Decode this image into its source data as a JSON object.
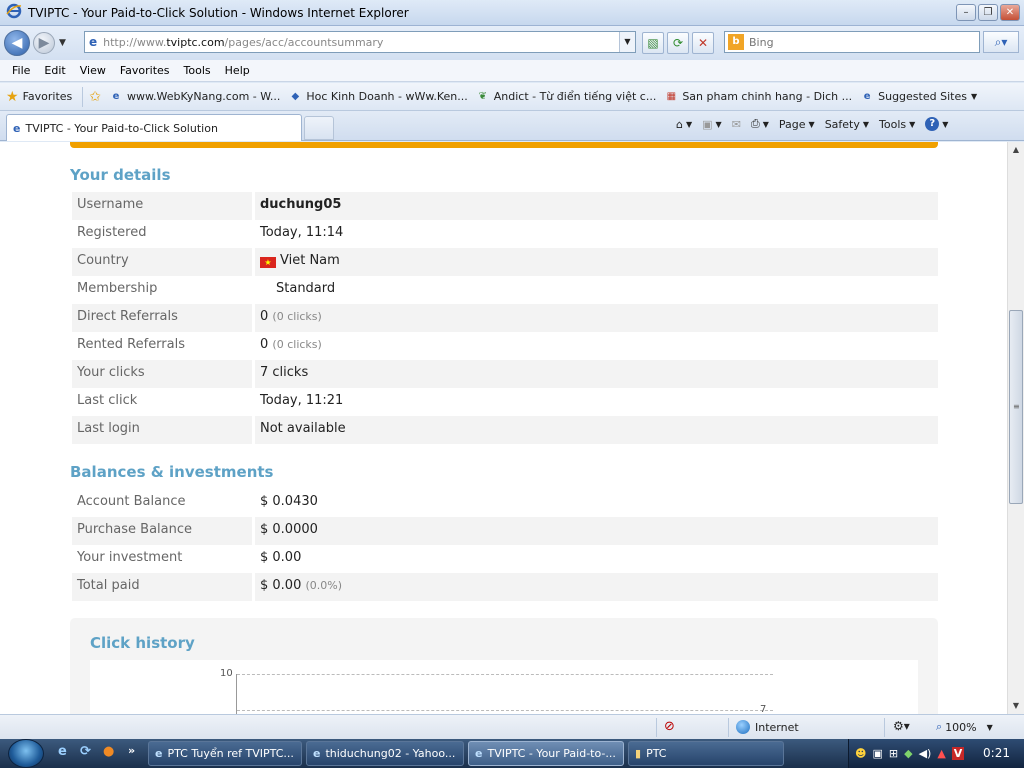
{
  "window": {
    "title": "TVIPTC - Your Paid-to-Click Solution - Windows Internet Explorer",
    "controls": [
      "–",
      "❐",
      "✕"
    ]
  },
  "address_bar": {
    "url_prefix": "http://www.",
    "url_domain": "tviptc.com",
    "url_path": "/pages/acc/accountsummary",
    "search_placeholder": "Bing"
  },
  "menu": [
    "File",
    "Edit",
    "View",
    "Favorites",
    "Tools",
    "Help"
  ],
  "favorites_bar": {
    "label": "Favorites",
    "items": [
      {
        "label": "www.WebKyNang.com - W...",
        "icon": "e"
      },
      {
        "label": "Hoc Kinh Doanh - wWw.Ken...",
        "icon": "◆"
      },
      {
        "label": "Andict - Từ điển tiếng việt c...",
        "icon": "❦"
      },
      {
        "label": "San pham chinh hang - Dich ...",
        "icon": "▦"
      },
      {
        "label": "Suggested Sites",
        "icon": "e"
      }
    ]
  },
  "tab": {
    "label": "TVIPTC - Your Paid-to-Click Solution"
  },
  "command_bar": {
    "page": "Page",
    "safety": "Safety",
    "tools": "Tools"
  },
  "details": {
    "title": "Your details",
    "rows": [
      {
        "label": "Username",
        "value": "duchung05",
        "note": ""
      },
      {
        "label": "Registered",
        "value": "Today, 11:14",
        "note": ""
      },
      {
        "label": "Country",
        "value": "Viet Nam",
        "note": ""
      },
      {
        "label": "Membership",
        "value": "Standard",
        "note": ""
      },
      {
        "label": "Direct Referrals",
        "value": "0",
        "note": "(0 clicks)"
      },
      {
        "label": "Rented Referrals",
        "value": "0",
        "note": "(0 clicks)"
      },
      {
        "label": "Your clicks",
        "value": "7 clicks",
        "note": ""
      },
      {
        "label": "Last click",
        "value": "Today, 11:21",
        "note": ""
      },
      {
        "label": "Last login",
        "value": "Not available",
        "note": ""
      }
    ]
  },
  "balances": {
    "title": "Balances & investments",
    "rows": [
      {
        "label": "Account Balance",
        "value": "$ 0.0430",
        "note": ""
      },
      {
        "label": "Purchase Balance",
        "value": "$ 0.0000",
        "note": ""
      },
      {
        "label": "Your investment",
        "value": "$ 0.00",
        "note": ""
      },
      {
        "label": "Total paid",
        "value": "$ 0.00",
        "note": "(0.0%)"
      }
    ]
  },
  "click_history": {
    "title": "Click history",
    "y_tick_top": "10",
    "point_label": "7"
  },
  "status_bar": {
    "zone": "Internet",
    "zoom": "100%"
  },
  "taskbar": {
    "tasks": [
      {
        "label": "PTC Tuyển ref TVIPTC...",
        "active": false
      },
      {
        "label": "thiduchung02 - Yahoo...",
        "active": false
      },
      {
        "label": "TVIPTC - Your Paid-to-...",
        "active": true
      },
      {
        "label": "PTC",
        "active": false
      }
    ],
    "clock": "0:21"
  },
  "colors": {
    "accent": "#5ea2c6",
    "orange": "#f0a000"
  }
}
